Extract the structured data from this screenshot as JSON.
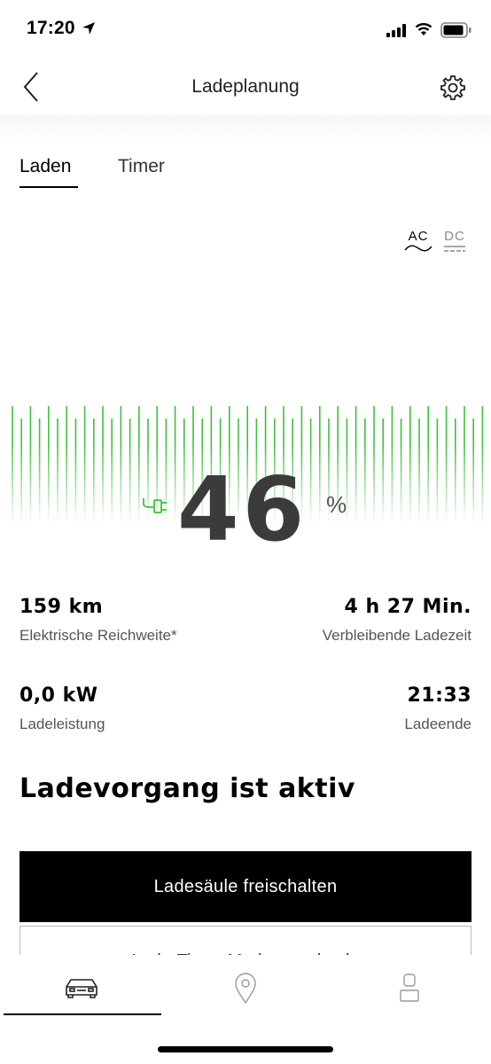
{
  "status_bar": {
    "time": "17:20"
  },
  "header": {
    "title": "Ladeplanung",
    "back_icon": "chevron-left-icon",
    "settings_icon": "gear-icon"
  },
  "tabs": [
    {
      "label": "Laden",
      "active": true
    },
    {
      "label": "Timer",
      "active": false
    }
  ],
  "current_type": {
    "ac_label": "AC",
    "dc_label": "DC",
    "selected": "AC"
  },
  "charge": {
    "state_of_charge": "46",
    "unit": "%",
    "color": "#3cc23c"
  },
  "stats": {
    "range_value": "159 km",
    "range_label": "Elektrische Reichweite*",
    "remaining_value": "4 h 27 Min.",
    "remaining_label": "Verbleibende Ladezeit",
    "power_value": "0,0 kW",
    "power_label": "Ladeleistung",
    "end_value": "21:33",
    "end_label": "Ladeende"
  },
  "status_heading": "Ladevorgang ist aktiv",
  "buttons": {
    "primary": "Ladesäule freischalten",
    "secondary": "Lade-Timer-Modus wechseln"
  },
  "tabbar": {
    "items": [
      "car-icon",
      "location-pin-icon",
      "user-icon"
    ],
    "active": "car-icon"
  }
}
